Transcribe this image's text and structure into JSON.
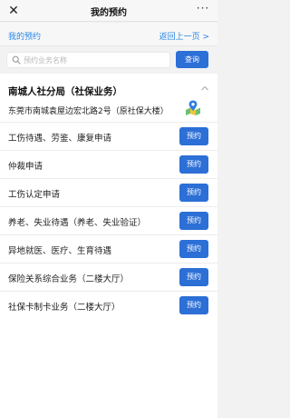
{
  "titlebar": {
    "close_icon": "close-icon",
    "title": "我的预约",
    "more_icon": "more-icon",
    "more_label": "···"
  },
  "subbar": {
    "left_label": "我的预约",
    "back_label": "返回上一页 >"
  },
  "search": {
    "placeholder": "预约业务名称",
    "value": "",
    "button_label": "查询",
    "icon": "search-icon"
  },
  "org": {
    "title": "南城人社分局（社保业务）",
    "address": "东莞市南城袁屋边宏北路2号（原社保大楼）",
    "map_icon": "map-pin-icon",
    "collapse_icon": "chevron-up-icon"
  },
  "services": [
    {
      "label": "工伤待遇、劳鉴、康复申请",
      "button": "预约"
    },
    {
      "label": "仲裁申请",
      "button": "预约"
    },
    {
      "label": "工伤认定申请",
      "button": "预约"
    },
    {
      "label": "养老、失业待遇（养老、失业验证）",
      "button": "预约"
    },
    {
      "label": "异地就医、医疗、生育待遇",
      "button": "预约"
    },
    {
      "label": "保险关系综合业务（二楼大厅）",
      "button": "预约"
    },
    {
      "label": "社保卡制卡业务（二楼大厅）",
      "button": "预约"
    }
  ],
  "colors": {
    "accent_blue": "#2c6fd6",
    "link_blue": "#2a86e6",
    "background": "#f2f2f2"
  }
}
